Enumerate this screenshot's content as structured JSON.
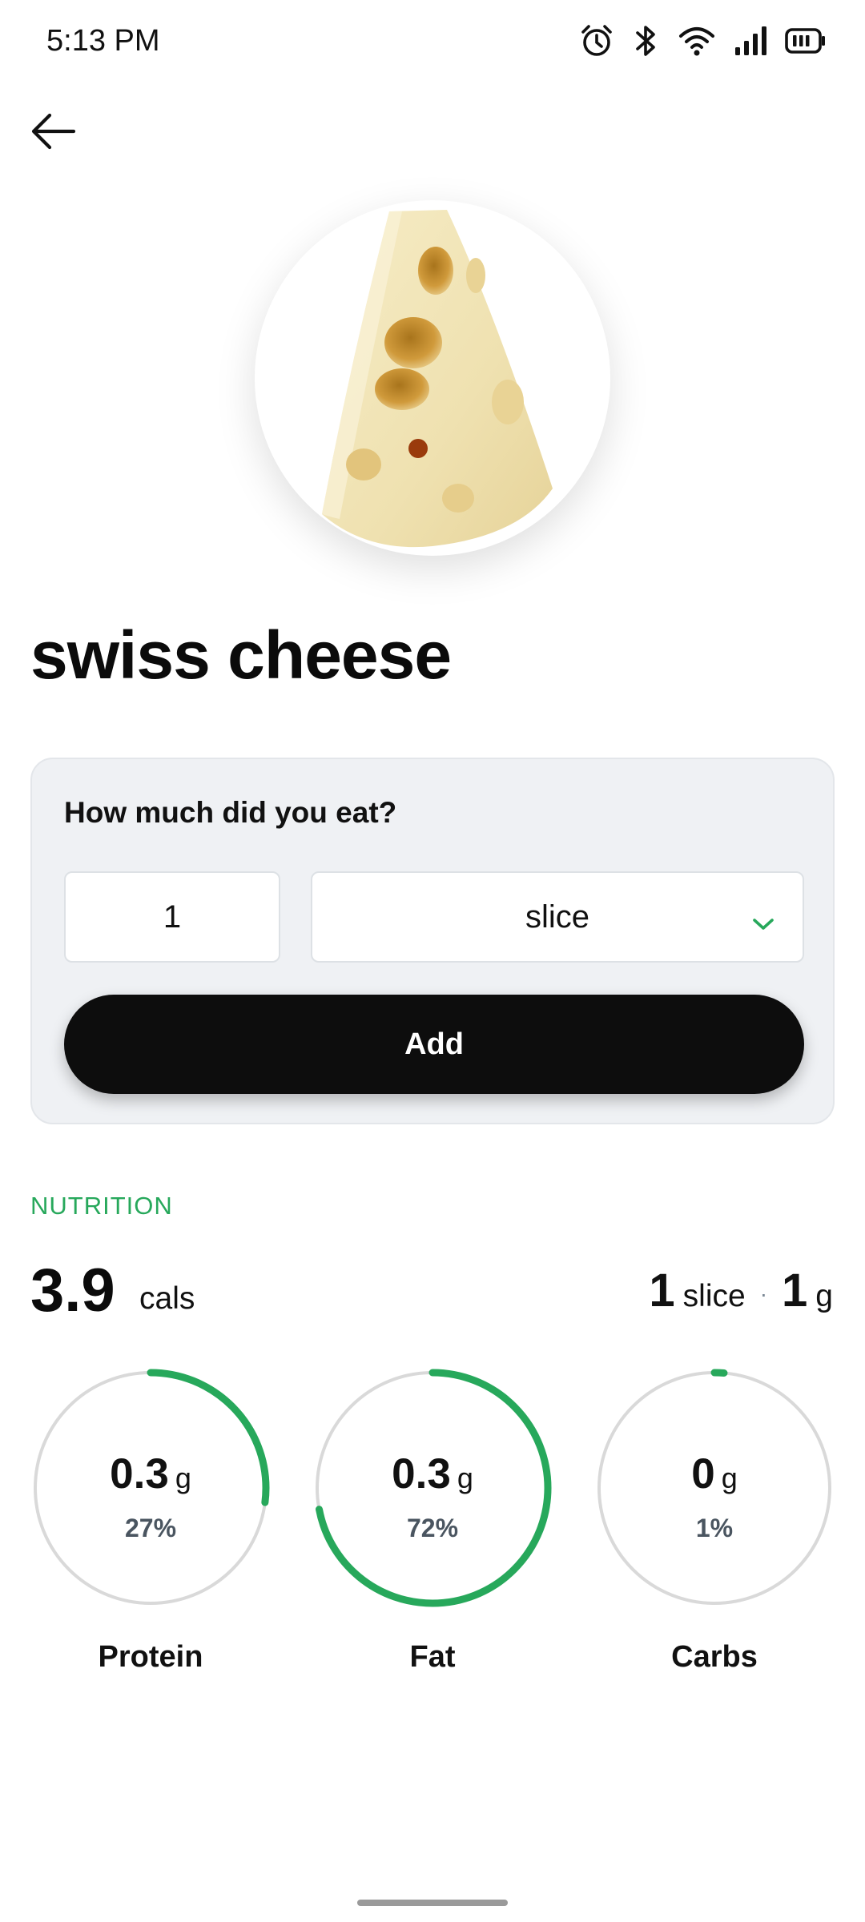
{
  "status_bar": {
    "time": "5:13 PM"
  },
  "food": {
    "name": "swiss cheese"
  },
  "portion": {
    "question": "How much did you eat?",
    "quantity": "1",
    "unit": "slice",
    "add_label": "Add"
  },
  "nutrition": {
    "heading": "NUTRITION",
    "calories": "3.9",
    "calories_unit": "cals",
    "serving_qty": "1",
    "serving_unit": "slice",
    "serving_sep": "·",
    "serving_weight": "1",
    "serving_weight_unit": "g",
    "macros": [
      {
        "label": "Protein",
        "amount": "0.3",
        "unit": "g",
        "percent_text": "27%",
        "progress": 0.27
      },
      {
        "label": "Fat",
        "amount": "0.3",
        "unit": "g",
        "percent_text": "72%",
        "progress": 0.72
      },
      {
        "label": "Carbs",
        "amount": "0",
        "unit": "g",
        "percent_text": "1%",
        "progress": 0.01
      }
    ]
  },
  "colors": {
    "accent": "#27a85b",
    "ring_track": "#d9d9d9",
    "button": "#0d0d0d",
    "card": "#eff1f4"
  },
  "icons": [
    "back-arrow-icon",
    "alarm-icon",
    "bluetooth-icon",
    "wifi-icon",
    "signal-icon",
    "battery-icon",
    "chevron-down-icon"
  ]
}
